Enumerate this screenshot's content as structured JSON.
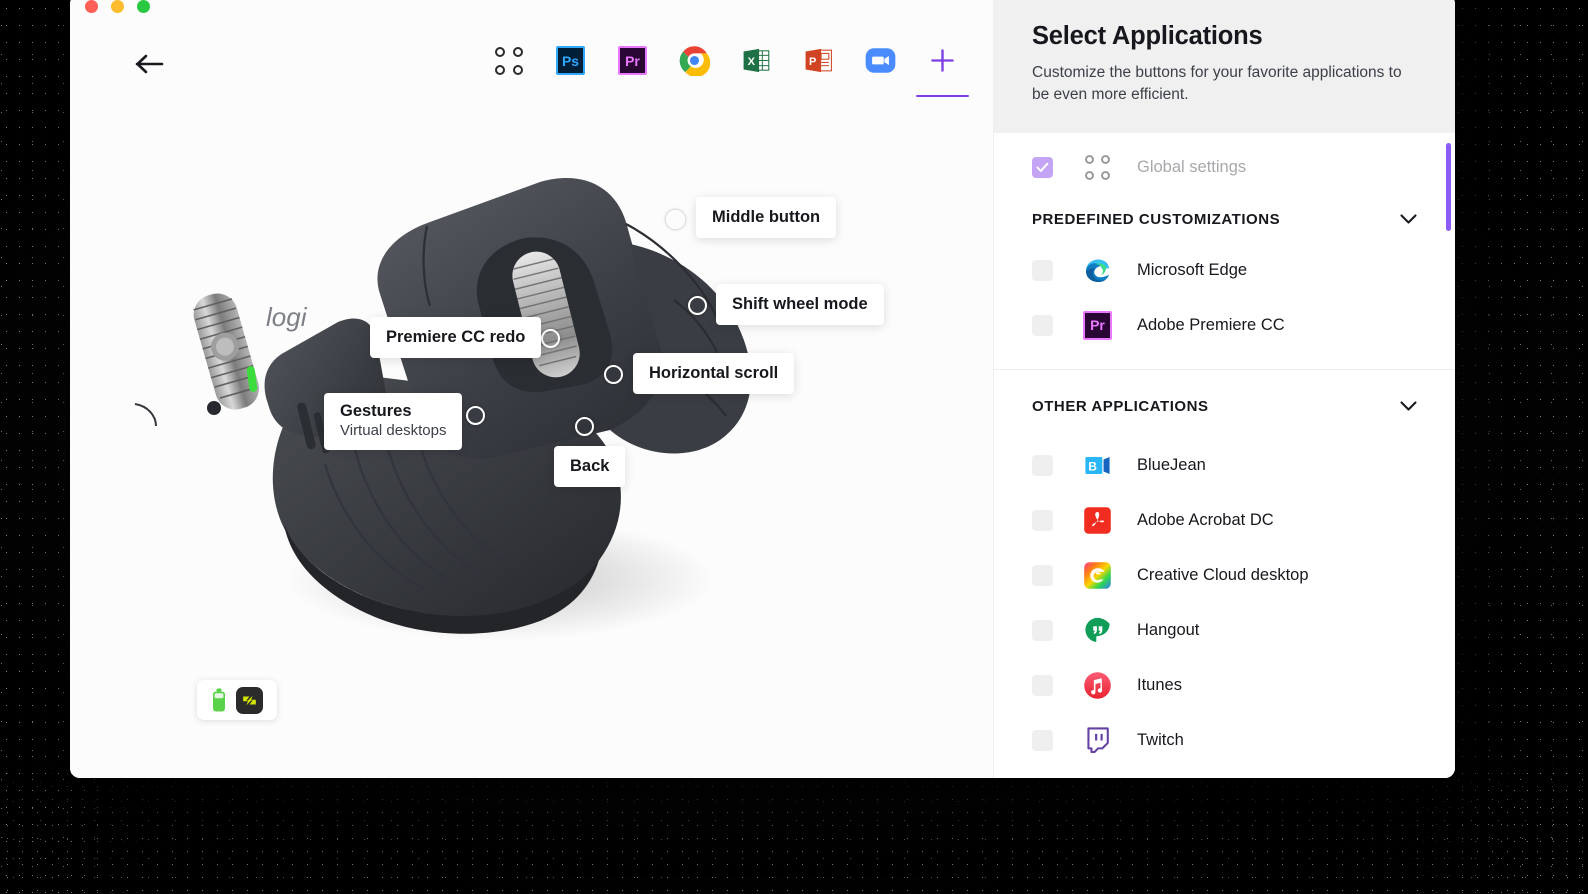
{
  "window": {
    "traffic_lights": [
      {
        "name": "close",
        "color": "#ff5f57"
      },
      {
        "name": "minimize",
        "color": "#febc2e"
      },
      {
        "name": "zoom",
        "color": "#28c840"
      }
    ],
    "back_label": "Back"
  },
  "toolbar": {
    "items": [
      {
        "name": "global-settings",
        "icon": "four-dots-icon",
        "label": "",
        "active": false
      },
      {
        "name": "photoshop",
        "icon": "photoshop-icon",
        "label": "Ps",
        "active": false
      },
      {
        "name": "premiere",
        "icon": "premiere-icon",
        "label": "Pr",
        "active": false
      },
      {
        "name": "chrome",
        "icon": "chrome-icon",
        "label": "",
        "active": false
      },
      {
        "name": "excel",
        "icon": "excel-icon",
        "label": "X",
        "active": false
      },
      {
        "name": "powerpoint",
        "icon": "powerpoint-icon",
        "label": "P",
        "active": false
      },
      {
        "name": "zoom-app",
        "icon": "zoom-video-icon",
        "label": "",
        "active": false
      },
      {
        "name": "add-application",
        "icon": "plus-icon",
        "label": "+",
        "active": true
      }
    ],
    "active_accent": "#7b3fe4"
  },
  "device": {
    "brand": "logi",
    "callouts": [
      {
        "id": "middle-button",
        "title": "Middle button",
        "subtitle": ""
      },
      {
        "id": "shift-wheel-mode",
        "title": "Shift wheel mode",
        "subtitle": ""
      },
      {
        "id": "premiere-cc-redo",
        "title": "Premiere CC redo",
        "subtitle": ""
      },
      {
        "id": "horizontal-scroll",
        "title": "Horizontal scroll",
        "subtitle": ""
      },
      {
        "id": "gestures",
        "title": "Gestures",
        "subtitle": "Virtual desktops"
      },
      {
        "id": "back",
        "title": "Back",
        "subtitle": ""
      }
    ]
  },
  "status": {
    "battery_icon": "battery-icon",
    "battery_color": "#5ad24a",
    "flow_icon": "flow-logo-icon",
    "flow_color": "#d3e600"
  },
  "panel": {
    "title": "Select Applications",
    "subtitle": "Customize the buttons for your favorite applications to be even more efficient.",
    "global": {
      "label": "Global settings",
      "checked": true,
      "checkbox_color": "#c4a4f4",
      "icon": "four-dots-icon"
    },
    "sections": [
      {
        "id": "predefined-customizations",
        "title": "PREDEFINED CUSTOMIZATIONS",
        "expanded": true,
        "items": [
          {
            "name": "microsoft-edge",
            "label": "Microsoft Edge",
            "icon": "edge-icon",
            "checked": false
          },
          {
            "name": "adobe-premiere-cc",
            "label": "Adobe Premiere CC",
            "icon": "premiere-icon",
            "checked": false
          }
        ]
      },
      {
        "id": "other-applications",
        "title": "OTHER APPLICATIONS",
        "expanded": true,
        "items": [
          {
            "name": "bluejean",
            "label": "BlueJean",
            "icon": "bluejeans-icon",
            "checked": false
          },
          {
            "name": "adobe-acrobat-dc",
            "label": "Adobe Acrobat DC",
            "icon": "acrobat-icon",
            "checked": false
          },
          {
            "name": "creative-cloud-desktop",
            "label": "Creative Cloud desktop",
            "icon": "creative-cloud-icon",
            "checked": false
          },
          {
            "name": "hangout",
            "label": "Hangout",
            "icon": "hangouts-icon",
            "checked": false
          },
          {
            "name": "itunes",
            "label": "Itunes",
            "icon": "itunes-icon",
            "checked": false
          },
          {
            "name": "twitch",
            "label": "Twitch",
            "icon": "twitch-icon",
            "checked": false
          }
        ]
      }
    ],
    "scrollbar_color": "#8b5cf6"
  }
}
